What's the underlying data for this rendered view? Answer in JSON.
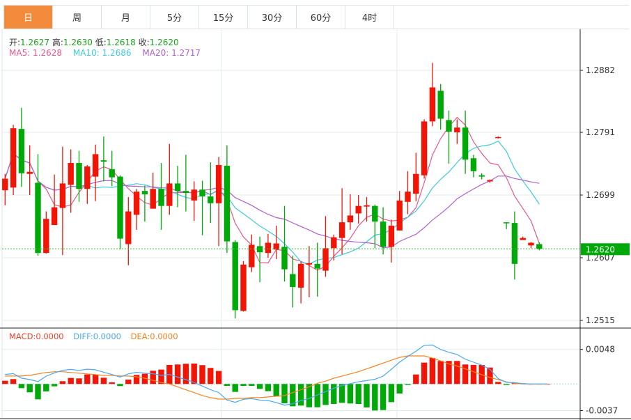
{
  "tabs": [
    "日",
    "周",
    "月",
    "5分",
    "15分",
    "30分",
    "60分",
    "4时"
  ],
  "active_tab": 0,
  "ohlc_legend": {
    "open_label": "开:",
    "open": "1.2627",
    "high_label": "高:",
    "high": "1.2630",
    "low_label": "低:",
    "low": "1.2618",
    "close_label": "收:",
    "close": "1.2620"
  },
  "ma_legend": {
    "ma5": "MA5: 1.2628",
    "ma10": "MA10: 1.2686",
    "ma20": "MA20: 1.2717"
  },
  "macd_legend": {
    "macd": "MACD:0.0000",
    "diff": "DIFF:0.0000",
    "dea": "DEA:0.0000"
  },
  "current_price": "1.2620",
  "colors": {
    "up": "#f21505",
    "down": "#00a808",
    "ma5": "#e8578a",
    "ma10": "#3ec8dc",
    "ma20": "#b05fcf",
    "diff": "#4aa8f0",
    "dea": "#f5821f",
    "accent": "#f28b3c"
  },
  "chart_data": {
    "type": "candlestick",
    "price_axis": {
      "ticks": [
        "1.2882",
        "1.2791",
        "1.2699",
        "1.2607",
        "1.2515"
      ],
      "ylim": [
        1.2497,
        1.292
      ]
    },
    "macd_axis": {
      "ticks": [
        "0.0048",
        "-0.0037"
      ],
      "ylim": [
        -0.005,
        0.0065
      ]
    },
    "candles": [
      [
        1.2706,
        1.273,
        1.2684,
        1.2723
      ],
      [
        1.271,
        1.2802,
        1.2699,
        1.2797
      ],
      [
        1.2796,
        1.2827,
        1.2711,
        1.2731
      ],
      [
        1.273,
        1.2772,
        1.2699,
        1.2733
      ],
      [
        1.2717,
        1.2759,
        1.261,
        1.2614
      ],
      [
        1.2614,
        1.2675,
        1.2613,
        1.2664
      ],
      [
        1.2655,
        1.2729,
        1.2655,
        1.2681
      ],
      [
        1.268,
        1.277,
        1.2611,
        1.2716
      ],
      [
        1.2714,
        1.2766,
        1.2673,
        1.2746
      ],
      [
        1.2746,
        1.2764,
        1.2689,
        1.2708
      ],
      [
        1.2708,
        1.2743,
        1.2686,
        1.2741
      ],
      [
        1.2726,
        1.2773,
        1.269,
        1.2759
      ],
      [
        1.275,
        1.2785,
        1.2719,
        1.2748
      ],
      [
        1.2737,
        1.2764,
        1.2712,
        1.2725
      ],
      [
        1.2726,
        1.2728,
        1.2619,
        1.2635
      ],
      [
        1.2627,
        1.2696,
        1.2596,
        1.2675
      ],
      [
        1.267,
        1.2708,
        1.2648,
        1.2704
      ],
      [
        1.2705,
        1.2713,
        1.266,
        1.27
      ],
      [
        1.2679,
        1.2732,
        1.2679,
        1.2708
      ],
      [
        1.2708,
        1.2746,
        1.2648,
        1.2683
      ],
      [
        1.2683,
        1.2774,
        1.267,
        1.2716
      ],
      [
        1.2716,
        1.2742,
        1.2681,
        1.2705
      ],
      [
        1.2705,
        1.2758,
        1.2675,
        1.2702
      ],
      [
        1.2691,
        1.2719,
        1.2661,
        1.2707
      ],
      [
        1.2707,
        1.272,
        1.264,
        1.2697
      ],
      [
        1.2697,
        1.2747,
        1.2658,
        1.2687
      ],
      [
        1.2687,
        1.2755,
        1.2624,
        1.2743
      ],
      [
        1.2742,
        1.2772,
        1.2614,
        1.2631
      ],
      [
        1.263,
        1.2633,
        1.2518,
        1.253
      ],
      [
        1.2529,
        1.2602,
        1.2528,
        1.2597
      ],
      [
        1.2593,
        1.2641,
        1.2586,
        1.2626
      ],
      [
        1.2624,
        1.2638,
        1.2571,
        1.2615
      ],
      [
        1.2614,
        1.2642,
        1.2607,
        1.2629
      ],
      [
        1.2619,
        1.2654,
        1.2605,
        1.2628
      ],
      [
        1.2623,
        1.2683,
        1.2572,
        1.259
      ],
      [
        1.2583,
        1.261,
        1.2534,
        1.2564
      ],
      [
        1.2563,
        1.2601,
        1.254,
        1.2598
      ],
      [
        1.2597,
        1.2624,
        1.2549,
        1.2599
      ],
      [
        1.2598,
        1.2629,
        1.255,
        1.2591
      ],
      [
        1.2588,
        1.2668,
        1.2579,
        1.2621
      ],
      [
        1.2621,
        1.2641,
        1.2603,
        1.2637
      ],
      [
        1.2636,
        1.2709,
        1.2612,
        1.2659
      ],
      [
        1.2659,
        1.27,
        1.2648,
        1.2669
      ],
      [
        1.2672,
        1.2699,
        1.2657,
        1.2683
      ],
      [
        1.2682,
        1.2696,
        1.266,
        1.2684
      ],
      [
        1.2683,
        1.2685,
        1.2621,
        1.266
      ],
      [
        1.266,
        1.2681,
        1.2612,
        1.2623
      ],
      [
        1.2623,
        1.2663,
        1.26,
        1.2654
      ],
      [
        1.2647,
        1.2705,
        1.2647,
        1.2691
      ],
      [
        1.2689,
        1.2734,
        1.2671,
        1.2704
      ],
      [
        1.2701,
        1.2761,
        1.269,
        1.273
      ],
      [
        1.2728,
        1.281,
        1.2723,
        1.2807
      ],
      [
        1.2807,
        1.2893,
        1.28,
        1.2857
      ],
      [
        1.2852,
        1.2862,
        1.2795,
        1.2811
      ],
      [
        1.2809,
        1.2823,
        1.2745,
        1.2792
      ],
      [
        1.2791,
        1.281,
        1.2774,
        1.2798
      ],
      [
        1.2798,
        1.2823,
        1.273,
        1.2751
      ],
      [
        1.2753,
        1.2758,
        1.2725,
        1.2734
      ],
      [
        1.2728,
        1.2731,
        1.2722,
        1.2726
      ],
      [
        1.2719,
        1.2722,
        1.2717,
        1.2721
      ],
      [
        1.2783,
        1.2785,
        1.2782,
        1.2784
      ],
      [
        1.2659,
        1.2659,
        1.2649,
        1.2658
      ],
      [
        1.2658,
        1.2675,
        1.2575,
        1.2598
      ],
      [
        1.2633,
        1.2638,
        1.2633,
        1.2636
      ],
      [
        1.2625,
        1.263,
        1.2621,
        1.2629
      ],
      [
        1.2627,
        1.263,
        1.2618,
        1.262
      ]
    ],
    "candle_format": [
      "open",
      "high",
      "low",
      "close"
    ],
    "macd_hist": [
      0.00045,
      0.00068,
      -0.00058,
      -0.00116,
      -0.00213,
      -0.00103,
      -0.00032,
      0.00039,
      0.00084,
      0.00078,
      0.00132,
      0.00132,
      0.00087,
      0.00023,
      -0.00029,
      0.00061,
      0.00126,
      0.00142,
      0.00184,
      0.002,
      0.00265,
      0.00271,
      0.00281,
      0.00284,
      0.00262,
      0.00223,
      0.00181,
      -0.00026,
      -0.0011,
      -0.00026,
      -0.00026,
      -0.00068,
      -0.001,
      -0.00174,
      -0.00268,
      -0.0031,
      -0.003,
      -0.00323,
      -0.00323,
      -0.00291,
      -0.00278,
      -0.00262,
      -0.00271,
      -0.00278,
      -0.00326,
      -0.00368,
      -0.00362,
      -0.00252,
      -0.00132,
      -0.00013,
      0.00132,
      0.00297,
      0.00362,
      0.0032,
      0.0032,
      0.0032,
      0.00271,
      0.00265,
      0.00265,
      0.00229,
      0.00029,
      -0.00013,
      0.00019,
      0.0001,
      0,
      0,
      0
    ],
    "dea": [
      0.0011,
      0.0011,
      0.0011,
      0.0012,
      0.0014,
      0.0016,
      0.0017,
      0.0017,
      0.0016,
      0.0015,
      0.0014,
      0.0013,
      0.0012,
      0.0012,
      0.0011,
      0.0011,
      0.001,
      0.0008,
      0.0005,
      0.0002,
      0.0,
      -0.0004,
      -0.0008,
      -0.0012,
      -0.0016,
      -0.0019,
      -0.0021,
      -0.0021,
      -0.002,
      -0.002,
      -0.0019,
      -0.0019,
      -0.0018,
      -0.0017,
      -0.0016,
      -0.0012,
      -0.0008,
      -0.0004,
      0.0001,
      0.0004,
      0.0008,
      0.0011,
      0.0014,
      0.0017,
      0.0021,
      0.0025,
      0.0029,
      0.0033,
      0.0037,
      0.0039,
      0.0039,
      0.0039,
      0.0036,
      0.0032,
      0.0028,
      0.0025,
      0.0021,
      0.0017,
      0.0013,
      0.0009,
      0.0006,
      0.0003,
      0.0001,
      0,
      0,
      0,
      0
    ],
    "ma_periods": [
      5,
      10,
      20
    ],
    "current_price_value": 1.262
  }
}
